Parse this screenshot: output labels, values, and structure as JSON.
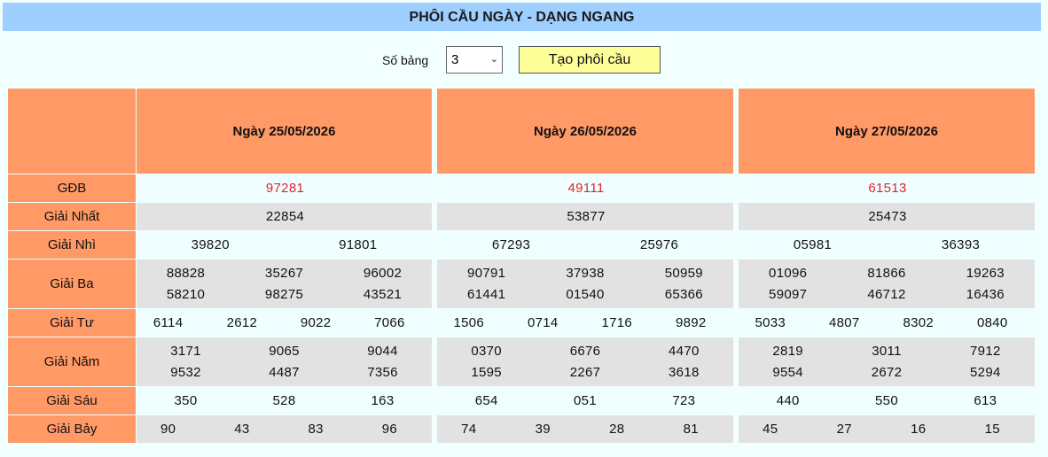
{
  "title": "PHÔI CẦU NGÀY - DẠNG NGANG",
  "controls": {
    "label": "Số bảng",
    "select_value": "3",
    "button": "Tạo phôi cầu"
  },
  "row_labels": [
    "GĐB",
    "Giải Nhất",
    "Giải Nhì",
    "Giải Ba",
    "Giải Tư",
    "Giải Năm",
    "Giải Sáu",
    "Giải Bảy"
  ],
  "tables": [
    {
      "date": "Ngày 25/05/2026",
      "gdb": [
        "97281"
      ],
      "nhat": [
        "22854"
      ],
      "nhi": [
        "39820",
        "91801"
      ],
      "ba": [
        [
          "88828",
          "35267",
          "96002"
        ],
        [
          "58210",
          "98275",
          "43521"
        ]
      ],
      "tu": [
        "6114",
        "2612",
        "9022",
        "7066"
      ],
      "nam": [
        [
          "3171",
          "9065",
          "9044"
        ],
        [
          "9532",
          "4487",
          "7356"
        ]
      ],
      "sau": [
        "350",
        "528",
        "163"
      ],
      "bay": [
        "90",
        "43",
        "83",
        "96"
      ]
    },
    {
      "date": "Ngày 26/05/2026",
      "gdb": [
        "49111"
      ],
      "nhat": [
        "53877"
      ],
      "nhi": [
        "67293",
        "25976"
      ],
      "ba": [
        [
          "90791",
          "37938",
          "50959"
        ],
        [
          "61441",
          "01540",
          "65366"
        ]
      ],
      "tu": [
        "1506",
        "0714",
        "1716",
        "9892"
      ],
      "nam": [
        [
          "0370",
          "6676",
          "4470"
        ],
        [
          "1595",
          "2267",
          "3618"
        ]
      ],
      "sau": [
        "654",
        "051",
        "723"
      ],
      "bay": [
        "74",
        "39",
        "28",
        "81"
      ]
    },
    {
      "date": "Ngày 27/05/2026",
      "gdb": [
        "61513"
      ],
      "nhat": [
        "25473"
      ],
      "nhi": [
        "05981",
        "36393"
      ],
      "ba": [
        [
          "01096",
          "81866",
          "19263"
        ],
        [
          "59097",
          "46712",
          "16436"
        ]
      ],
      "tu": [
        "5033",
        "4807",
        "8302",
        "0840"
      ],
      "nam": [
        [
          "2819",
          "3011",
          "7912"
        ],
        [
          "9554",
          "2672",
          "5294"
        ]
      ],
      "sau": [
        "440",
        "550",
        "613"
      ],
      "bay": [
        "45",
        "27",
        "16",
        "15"
      ]
    }
  ],
  "colors": {
    "header": "#ff9966",
    "special_prize": "#e0242a",
    "title_bar": "#9fcfff",
    "button": "#ffff99"
  }
}
